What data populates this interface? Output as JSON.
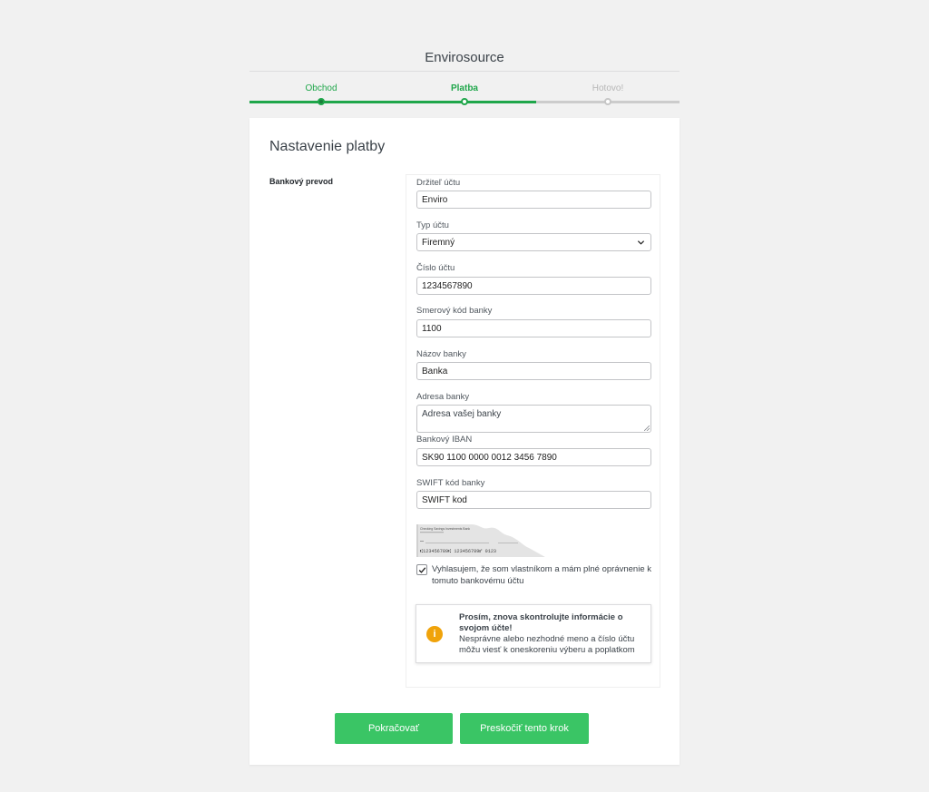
{
  "header": {
    "title": "Envirosource"
  },
  "steps": [
    {
      "label": "Obchod",
      "state": "done"
    },
    {
      "label": "Platba",
      "state": "active"
    },
    {
      "label": "Hotovo!",
      "state": "todo"
    }
  ],
  "colors": {
    "accent": "#1fa64a",
    "button": "#3ac565",
    "warning": "#f0a30a"
  },
  "card": {
    "title": "Nastavenie platby",
    "section_label": "Bankový prevod"
  },
  "form": {
    "account_holder": {
      "label": "Držiteľ účtu",
      "value": "Enviro"
    },
    "account_type": {
      "label": "Typ účtu",
      "value": "Firemný"
    },
    "account_number": {
      "label": "Číslo účtu",
      "value": "1234567890"
    },
    "routing_code": {
      "label": "Smerový kód banky",
      "value": "1100"
    },
    "bank_name": {
      "label": "Názov banky",
      "value": "Banka"
    },
    "bank_address": {
      "label": "Adresa banky",
      "placeholder": "Adresa vašej banky"
    },
    "iban": {
      "label": "Bankový IBAN",
      "value": "SK90 1100 0000 0012 3456 7890"
    },
    "swift": {
      "label": "SWIFT kód banky",
      "value": "SWIFT kod"
    }
  },
  "cheque": {
    "bank": "Checking Savings Investments Bank",
    "numbers": "⑆123456789⑆  123456789⑈  0123"
  },
  "confirm": {
    "checked": true,
    "text": "Vyhlasujem, že som vlastníkom a mám plné oprávnenie k tomuto bankovému účtu"
  },
  "notice": {
    "icon": "info-icon",
    "title": "Prosím, znova skontrolujte informácie o svojom účte!",
    "body": "Nesprávne alebo nezhodné meno a číslo účtu môžu viesť k oneskoreniu výberu a poplatkom"
  },
  "buttons": {
    "continue": "Pokračovať",
    "skip": "Preskočiť tento krok"
  }
}
